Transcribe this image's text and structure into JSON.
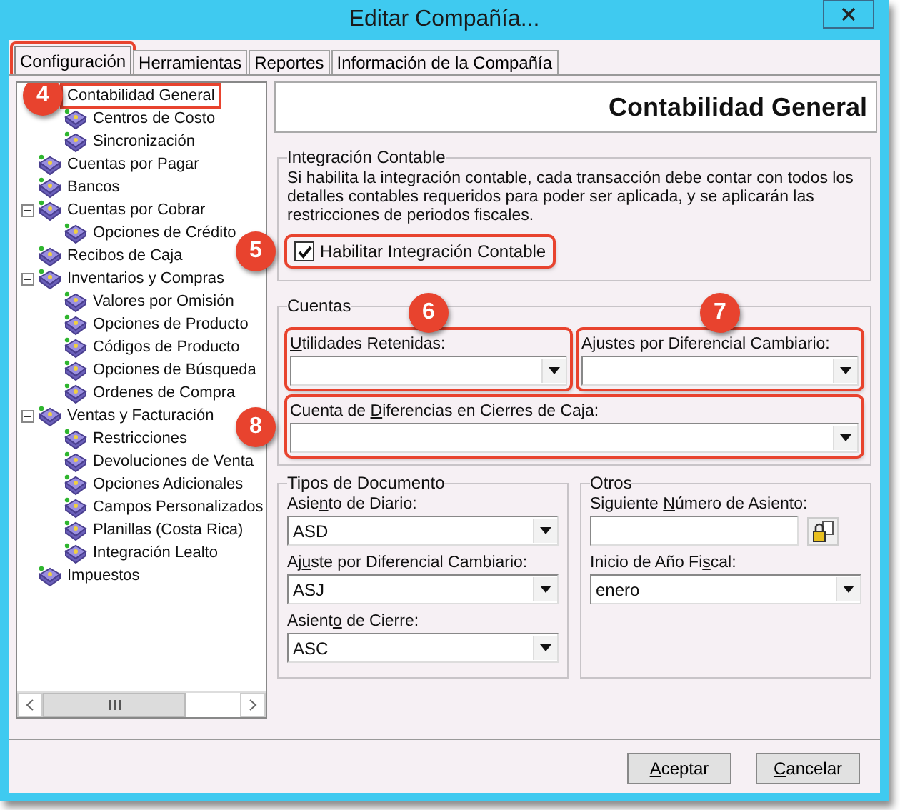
{
  "window": {
    "title": "Editar Compañía..."
  },
  "tabs": [
    {
      "label": "Configuración",
      "selected": true,
      "highlighted": true
    },
    {
      "label": "Herramientas",
      "selected": false,
      "highlighted": false
    },
    {
      "label": "Reportes",
      "selected": false,
      "highlighted": false
    },
    {
      "label": "Información de la Compañía",
      "selected": false,
      "highlighted": false
    }
  ],
  "tree": [
    {
      "label": "Contabilidad General",
      "highlighted": true,
      "callout": "4",
      "expanded": true,
      "children": [
        {
          "label": "Centros de Costo"
        },
        {
          "label": "Sincronización"
        }
      ]
    },
    {
      "label": "Cuentas por Pagar"
    },
    {
      "label": "Bancos"
    },
    {
      "label": "Cuentas por Cobrar",
      "expanded": true,
      "children": [
        {
          "label": "Opciones de Crédito"
        }
      ]
    },
    {
      "label": "Recibos de Caja"
    },
    {
      "label": "Inventarios y Compras",
      "expanded": true,
      "children": [
        {
          "label": "Valores por Omisión"
        },
        {
          "label": "Opciones de Producto"
        },
        {
          "label": "Códigos de Producto"
        },
        {
          "label": "Opciones de Búsqueda"
        },
        {
          "label": "Ordenes de Compra"
        }
      ]
    },
    {
      "label": "Ventas y Facturación",
      "expanded": true,
      "children": [
        {
          "label": "Restricciones"
        },
        {
          "label": "Devoluciones de Venta"
        },
        {
          "label": "Opciones Adicionales"
        },
        {
          "label": "Campos Personalizados"
        },
        {
          "label": "Planillas (Costa Rica)"
        },
        {
          "label": "Integración Lealto"
        }
      ]
    },
    {
      "label": "Impuestos"
    }
  ],
  "page_title": "Contabilidad General",
  "integration": {
    "legend": "Integración Contable",
    "description": "Si habilita la integración contable, cada transacción debe contar con todos los detalles contables requeridos para poder ser aplicada, y se aplicarán las restricciones de periodos fiscales.",
    "checkbox": {
      "label": "Habilitar Integración Contable",
      "checked": true,
      "highlighted": true,
      "callout": "5"
    }
  },
  "accounts": {
    "legend": "Cuentas",
    "fields": [
      {
        "kind": "half",
        "label": {
          "key": "U",
          "post": "tilidades Retenidas:"
        },
        "highlighted": true,
        "callout": "6"
      },
      {
        "kind": "half",
        "label": {
          "post": "Ajustes por Diferencial Cambiario:"
        },
        "highlighted": true,
        "callout": "7"
      },
      {
        "kind": "wide",
        "label": {
          "pre": "Cuenta de ",
          "key": "D",
          "post": "iferencias en Cierres de Caja:"
        },
        "highlighted": true,
        "callout": "8"
      }
    ]
  },
  "document_types": {
    "legend": "Tipos de Documento",
    "fields": [
      {
        "label": {
          "pre": "Asie",
          "key": "n",
          "post": "to de Diario:"
        },
        "value": "ASD"
      },
      {
        "label": {
          "pre": "Aj",
          "key": "u",
          "post": "ste por Diferencial Cambiario:"
        },
        "value": "ASJ"
      },
      {
        "label": {
          "pre": "Asient",
          "key": "o",
          "post": " de Cierre:"
        },
        "value": "ASC"
      }
    ]
  },
  "others": {
    "legend": "Otros",
    "fields": [
      {
        "kind": "text",
        "label": {
          "pre": "Siguiente ",
          "key": "N",
          "post": "úmero de Asiento:"
        }
      },
      {
        "kind": "select",
        "label": {
          "pre": "Inicio de Año Fi",
          "key": "s",
          "post": "cal:"
        },
        "value": "enero"
      }
    ]
  },
  "buttons": [
    {
      "label": {
        "key": "A",
        "post": "ceptar"
      }
    },
    {
      "label": {
        "key": "C",
        "post": "ancelar"
      }
    }
  ]
}
